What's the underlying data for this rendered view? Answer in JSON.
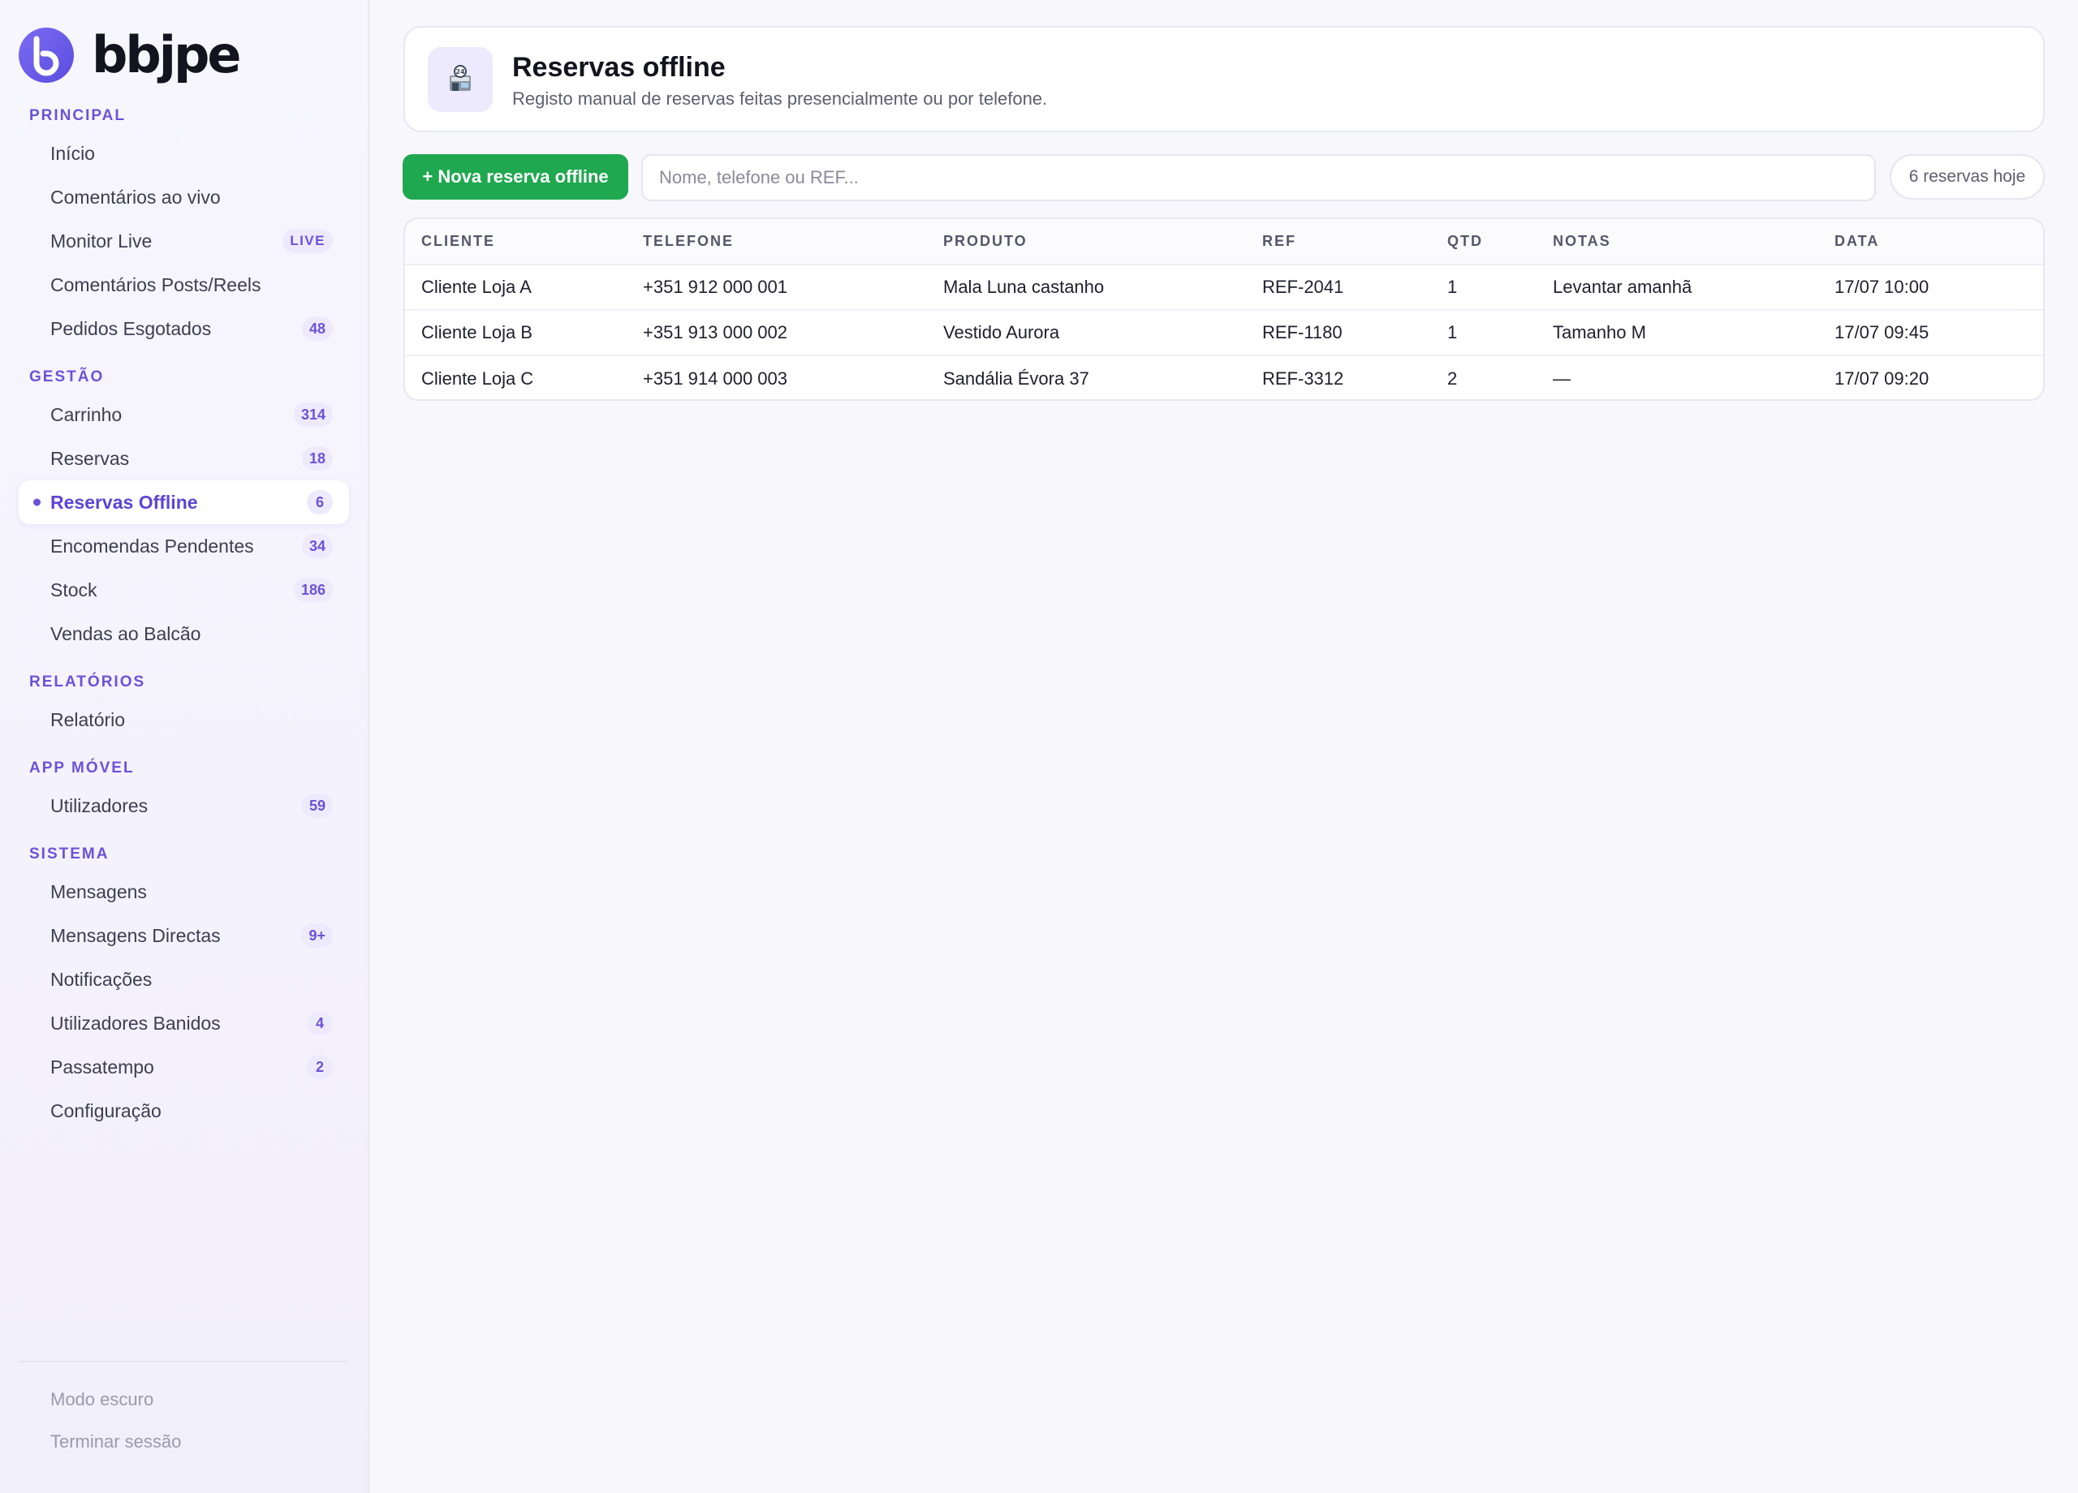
{
  "brand": {
    "name": "bbjpe"
  },
  "sidebar": {
    "sections": [
      {
        "title": "PRINCIPAL",
        "items": [
          {
            "label": "Início",
            "badge": ""
          },
          {
            "label": "Comentários ao vivo",
            "badge": ""
          },
          {
            "label": "Monitor Live",
            "badge": "LIVE"
          },
          {
            "label": "Comentários Posts/Reels",
            "badge": ""
          },
          {
            "label": "Pedidos Esgotados",
            "badge": "48"
          }
        ]
      },
      {
        "title": "GESTÃO",
        "items": [
          {
            "label": "Carrinho",
            "badge": "314"
          },
          {
            "label": "Reservas",
            "badge": "18"
          },
          {
            "label": "Reservas Offline",
            "badge": "6",
            "active": true
          },
          {
            "label": "Encomendas Pendentes",
            "badge": "34"
          },
          {
            "label": "Stock",
            "badge": "186"
          },
          {
            "label": "Vendas ao Balcão",
            "badge": ""
          }
        ]
      },
      {
        "title": "RELATÓRIOS",
        "items": [
          {
            "label": "Relatório",
            "badge": ""
          }
        ]
      },
      {
        "title": "APP MÓVEL",
        "items": [
          {
            "label": "Utilizadores",
            "badge": "59"
          }
        ]
      },
      {
        "title": "SISTEMA",
        "items": [
          {
            "label": "Mensagens",
            "badge": ""
          },
          {
            "label": "Mensagens Directas",
            "badge": "9+"
          },
          {
            "label": "Notificações",
            "badge": ""
          },
          {
            "label": "Utilizadores Banidos",
            "badge": "4"
          },
          {
            "label": "Passatempo",
            "badge": "2"
          },
          {
            "label": "Configuração",
            "badge": ""
          }
        ]
      }
    ],
    "footer": {
      "dark_mode": "Modo escuro",
      "logout": "Terminar sessão"
    }
  },
  "header": {
    "icon": "store-icon",
    "title": "Reservas offline",
    "subtitle": "Registo manual de reservas feitas presencialmente ou por telefone."
  },
  "toolbar": {
    "new_button": "+ Nova reserva offline",
    "search_placeholder": "Nome, telefone ou REF...",
    "count": "6 reservas hoje"
  },
  "table": {
    "columns": [
      "CLIENTE",
      "TELEFONE",
      "PRODUTO",
      "REF",
      "QTD",
      "NOTAS",
      "DATA"
    ],
    "rows": [
      [
        "Cliente Loja A",
        "+351 912 000 001",
        "Mala Luna castanho",
        "REF-2041",
        "1",
        "Levantar amanhã",
        "17/07 10:00"
      ],
      [
        "Cliente Loja B",
        "+351 913 000 002",
        "Vestido Aurora",
        "REF-1180",
        "1",
        "Tamanho M",
        "17/07 09:45"
      ],
      [
        "Cliente Loja C",
        "+351 914 000 003",
        "Sandália Évora 37",
        "REF-3312",
        "2",
        "—",
        "17/07 09:20"
      ]
    ]
  },
  "colors": {
    "accent": "#6b52d8",
    "primary_button": "#1fa84f",
    "background": "#f7f7fc"
  }
}
